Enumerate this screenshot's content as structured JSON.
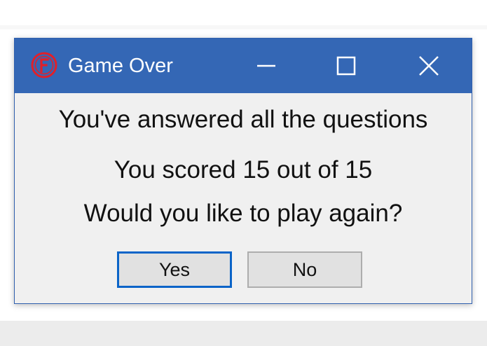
{
  "window": {
    "title": "Game Over",
    "app_icon": "red-circle-f-icon",
    "controls": {
      "minimize": "minimize-icon",
      "maximize": "maximize-icon",
      "close": "close-icon"
    }
  },
  "message": {
    "line1": "You've answered all the questions",
    "line2": "You scored 15 out of 15",
    "line3": "Would you like to play again?"
  },
  "buttons": {
    "yes_label": "Yes",
    "no_label": "No"
  },
  "colors": {
    "titlebar": "#3467b5",
    "dialog_bg": "#f0f0f0",
    "focus_border": "#0a64c8",
    "icon_red": "#e0202a"
  }
}
